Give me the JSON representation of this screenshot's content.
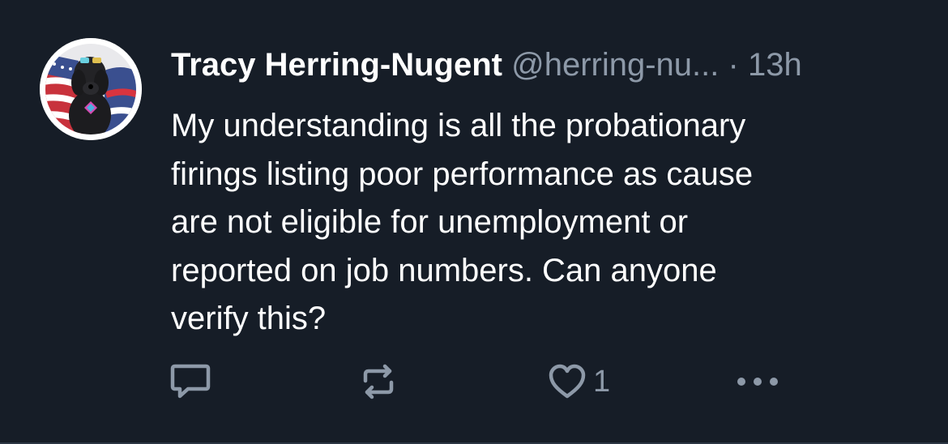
{
  "post": {
    "author_name": "Tracy Herring-Nugent",
    "handle": "@herring-nu...",
    "separator": "·",
    "time": "13h",
    "body_lines": [
      "My understanding is all the probationary",
      "firings listing poor performance as cause",
      "are not eligible for unemployment or",
      "reported on job numbers.  Can anyone",
      "verify this?"
    ]
  },
  "actions": {
    "reply_icon": "reply-bubble-icon",
    "repost_icon": "repost-arrows-icon",
    "like_icon": "heart-outline-icon",
    "like_count": "1",
    "more_icon": "ellipsis-icon"
  },
  "colors": {
    "background": "#161d27",
    "text": "#ffffff",
    "muted": "#8d99a8"
  }
}
